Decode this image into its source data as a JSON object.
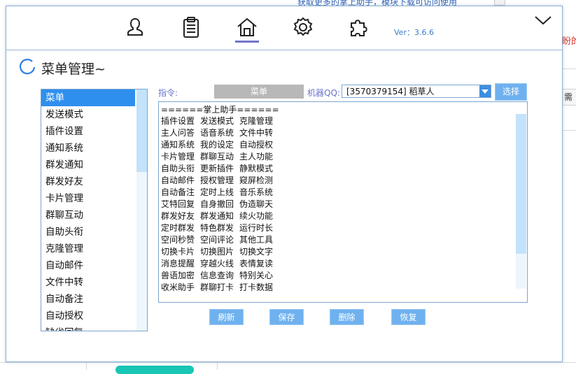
{
  "background": {
    "top_text": "获取更多的掌上助手，模块下载可访问使用",
    "right_red_text": "盼的",
    "right_box_text": "需"
  },
  "toolbar": {
    "icons": [
      "user-icon",
      "clipboard-icon",
      "home-icon",
      "settings-icon",
      "plugin-icon"
    ],
    "active": "home-icon",
    "version": "Ver：3.6.6"
  },
  "page": {
    "title": "菜单管理~"
  },
  "menu": {
    "selected": "菜单",
    "items": [
      "菜单",
      "发送模式",
      "插件设置",
      "通知系统",
      "群发通知",
      "群发好友",
      "卡片管理",
      "群聊互动",
      "自助头衔",
      "克隆管理",
      "自动邮件",
      "文件中转",
      "自动备注",
      "自动授权",
      "缺省回复"
    ]
  },
  "command": {
    "label": "指令:",
    "value": "菜单",
    "robot_label": "机器QQ:",
    "robot_value": "[3570379154]  稻草人",
    "choose_label": "选择"
  },
  "content": {
    "title": "======掌上助手======",
    "rows": [
      [
        "插件设置",
        "发送模式",
        "克隆管理"
      ],
      [
        "主人问答",
        "语音系统",
        "文件中转"
      ],
      [
        "通知系统",
        "我的设定",
        "自动授权"
      ],
      [
        "卡片管理",
        "群聊互动",
        "主人功能"
      ],
      [
        "自助头衔",
        "更新插件",
        "静默模式"
      ],
      [
        "自动邮件",
        "授权管理",
        "窥屏检测"
      ],
      [
        "自动备注",
        "定时上线",
        "音乐系统"
      ],
      [
        "艾特回复",
        "自身撤回",
        "伪造聊天"
      ],
      [
        "群发好友",
        "群发通知",
        "续火功能"
      ],
      [
        "定时群发",
        "特色群发",
        "运行时长"
      ],
      [
        "空间秒赞",
        "空间评论",
        "其他工具"
      ],
      [
        "切换卡片",
        "切换图片",
        "切换文字"
      ],
      [
        "消息提醒",
        "穿越火线",
        "表情复读"
      ],
      [
        "兽语加密",
        "信息查询",
        "特别关心"
      ],
      [
        "收米助手",
        "群聊打卡",
        "打卡数据"
      ]
    ]
  },
  "actions": {
    "refresh": "刷新",
    "save": "保存",
    "delete": "删除",
    "restore": "恢复"
  },
  "colors": {
    "accent": "#6fb1ef",
    "selected": "#2f8fee",
    "label": "#6b74c8",
    "border": "#7ca5cf"
  }
}
